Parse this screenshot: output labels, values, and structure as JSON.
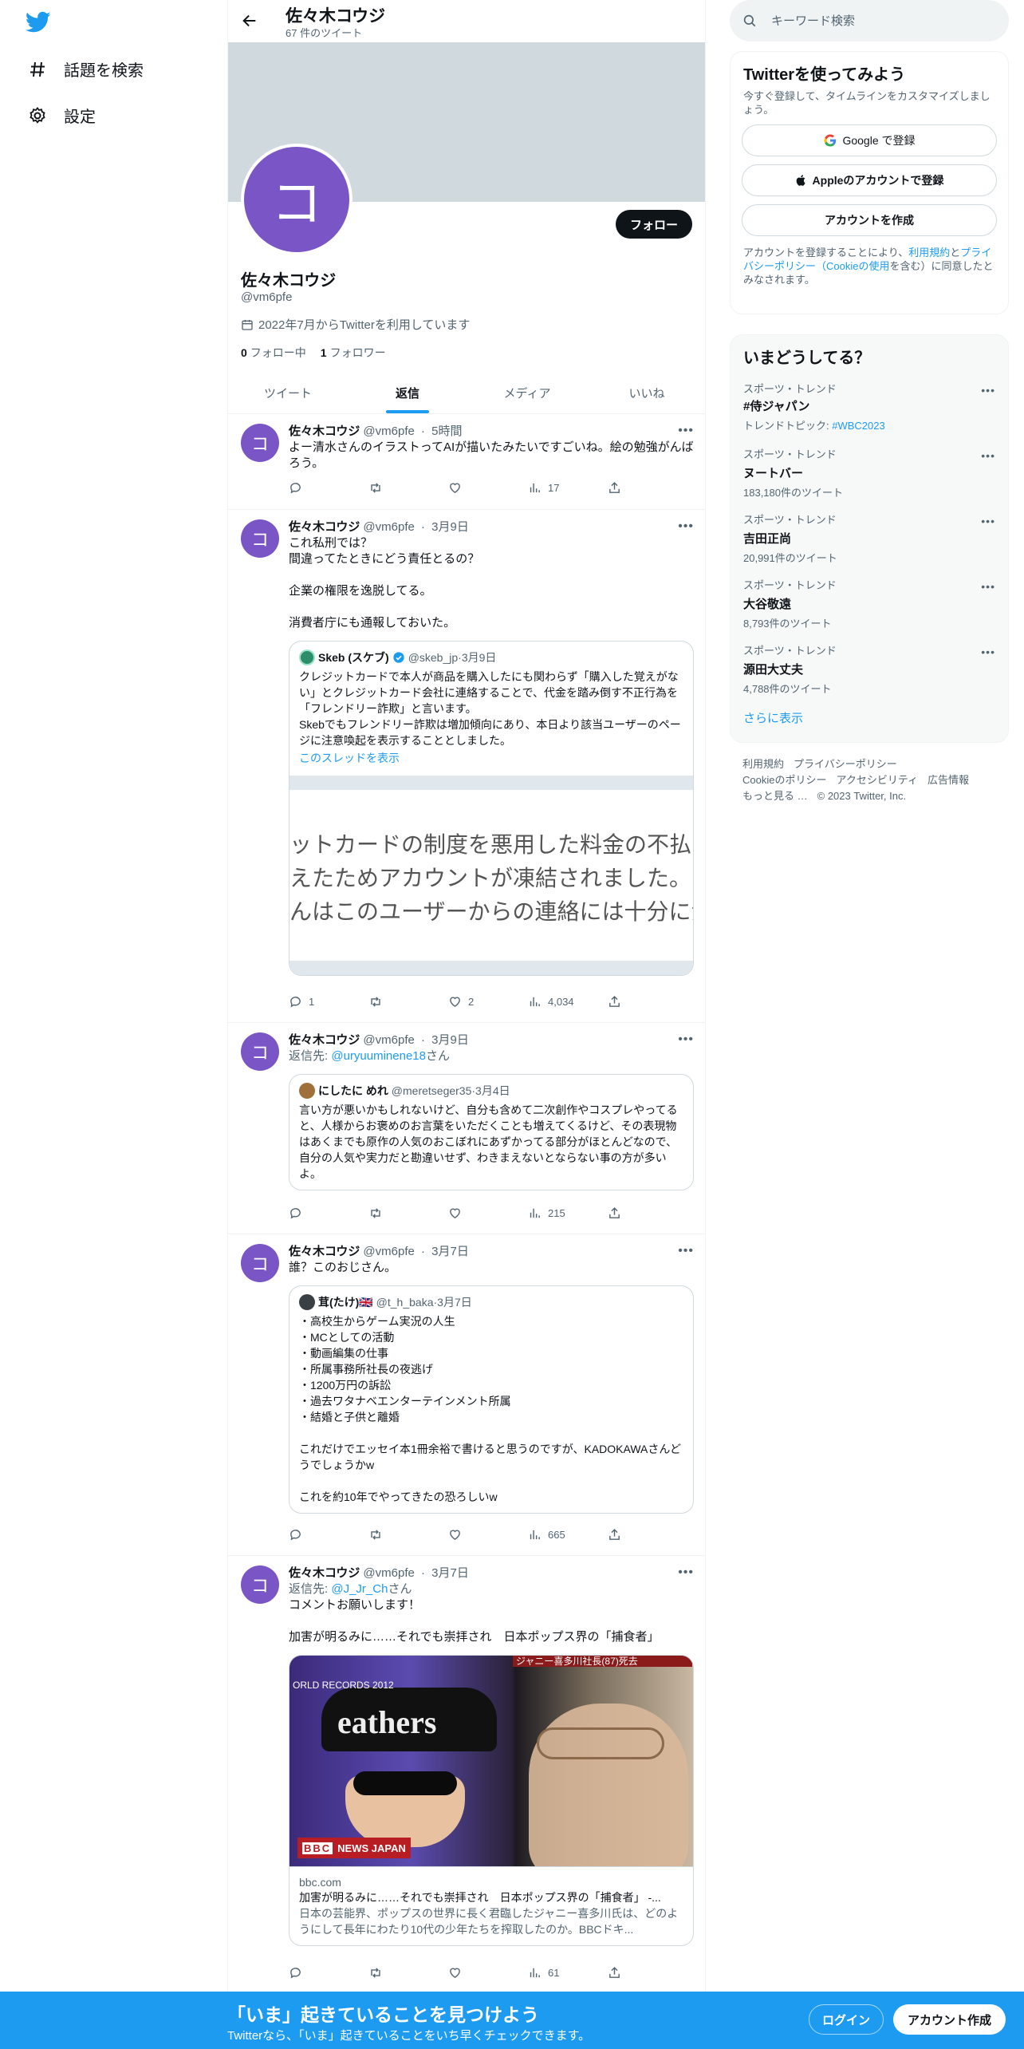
{
  "nav": {
    "explore_label": "話題を検索",
    "settings_label": "設定"
  },
  "header": {
    "name": "佐々木コウジ",
    "tweet_count": "67 件のツイート"
  },
  "profile": {
    "avatar_letter": "コ",
    "follow_label": "フォロー",
    "name": "佐々木コウジ",
    "handle": "@vm6pfe",
    "joined": "2022年7月からTwitterを利用しています",
    "following_count": "0",
    "following_label": "フォロー中",
    "followers_count": "1",
    "followers_label": "フォロワー"
  },
  "tabs": [
    {
      "label": "ツイート",
      "active": false
    },
    {
      "label": "返信",
      "active": true
    },
    {
      "label": "メディア",
      "active": false
    },
    {
      "label": "いいね",
      "active": false
    }
  ],
  "tweets": [
    {
      "name": "佐々木コウジ",
      "handle": "@vm6pfe",
      "time": "5時間",
      "text": "よー清水さんのイラストってAIが描いたみたいですごいね。絵の勉強がんばろう。",
      "replies": "",
      "retweets": "",
      "likes": "",
      "views": "17"
    },
    {
      "name": "佐々木コウジ",
      "handle": "@vm6pfe",
      "time": "3月9日",
      "text": "これ私刑では？\n間違ってたときにどう責任とるの？\n\n企業の権限を逸脱してる。\n\n消費者庁にも通報しておいた。",
      "quote": {
        "name": "Skeb (スケブ)",
        "handle": "@skeb_jp",
        "time": "3月9日",
        "text": "クレジットカードで本人が商品を購入したにも関わらず「購入した覚えがない」とクレジットカード会社に連絡することで、代金を踏み倒す不正行為を「フレンドリー詐欺」と言います。\nSkebでもフレンドリー詐欺は増加傾向にあり、本日より該当ユーザーのページに注意喚起を表示することとしました。",
        "thread_link": "このスレッドを表示",
        "image_lines": [
          "ットカードの制度を悪用した料金の不払い",
          "えたためアカウントが凍結されました。",
          "んはこのユーザーからの連絡には十分に注"
        ]
      },
      "replies": "1",
      "retweets": "",
      "likes": "2",
      "views": "4,034"
    },
    {
      "name": "佐々木コウジ",
      "handle": "@vm6pfe",
      "time": "3月9日",
      "reply_prefix": "返信先: ",
      "reply_to": "@uryuuminene18",
      "reply_suffix": "さん",
      "quote": {
        "name": "にしたに めれ",
        "handle": "@meretseger35",
        "time": "3月4日",
        "text": "言い方が悪いかもしれないけど、自分も含めて二次創作やコスプレやってると、人様からお褒めのお言葉をいただくことも増えてくるけど、その表現物はあくまでも原作の人気のおこぼれにあずかってる部分がほとんどなので、自分の人気や実力だと勘違いせず、わきまえないとならない事の方が多いよ。"
      },
      "replies": "",
      "retweets": "",
      "likes": "",
      "views": "215"
    },
    {
      "name": "佐々木コウジ",
      "handle": "@vm6pfe",
      "time": "3月7日",
      "text": "誰？このおじさん。",
      "quote": {
        "name": "茸(たけ)🇬🇧",
        "handle": "@t_h_baka",
        "time": "3月7日",
        "text": "・高校生からゲーム実況の人生\n・MCとしての活動\n・動画編集の仕事\n・所属事務所社長の夜逃げ\n・1200万円の訴訟\n・過去ワタナベエンターテインメント所属\n・結婚と子供と離婚\n\nこれだけでエッセイ本1冊余裕で書けると思うのですが、KADOKAWAさんどうでしょうかw\n\nこれを約10年でやってきたの恐ろしいw"
      },
      "replies": "",
      "retweets": "",
      "likes": "",
      "views": "665"
    },
    {
      "name": "佐々木コウジ",
      "handle": "@vm6pfe",
      "time": "3月7日",
      "reply_prefix": "返信先: ",
      "reply_to": "@J_Jr_Ch",
      "reply_suffix": "さん",
      "text": "コメントお願いします！\n\n加害が明るみに……それでも崇拝され　日本ポップス界の「捕食者」",
      "card": {
        "domain": "bbc.com",
        "title": "加害が明るみに……それでも崇拝され　日本ポップス界の「捕食者」 -...",
        "desc": "日本の芸能界、ポップスの世界に長く君臨したジャニー喜多川氏は、どのようにして長年にわたり10代の少年たちを搾取したのか。BBCドキ...",
        "image_caption": "ジャニー喜多川社長(87)死去",
        "cap_text": "eathers",
        "record_text": "ORLD RECORDS 2012",
        "bbc_badge": "BBC",
        "news_label": "NEWS JAPAN"
      },
      "replies": "",
      "retweets": "",
      "likes": "",
      "views": "61"
    }
  ],
  "search": {
    "placeholder": "キーワード検索"
  },
  "signup": {
    "title": "Twitterを使ってみよう",
    "subtitle": "今すぐ登録して、タイムラインをカスタマイズしましょう。",
    "google_label": "Google で登録",
    "apple_label": "Appleのアカウントで登録",
    "create_label": "アカウントを作成",
    "terms_1": "アカウントを登録することにより、",
    "terms_link1": "利用規約",
    "terms_2": "と",
    "terms_link2": "プライバシーポリシー（Cookieの使用",
    "terms_3": "を含む）に同意したとみなされます。"
  },
  "trends": {
    "title": "いまどうしてる？",
    "items": [
      {
        "category": "スポーツ・トレンド",
        "name": "#侍ジャパン",
        "extra_prefix": "トレンドトピック: ",
        "extra_link": "#WBC2023"
      },
      {
        "category": "スポーツ・トレンド",
        "name": "ヌートバー",
        "count": "183,180件のツイート"
      },
      {
        "category": "スポーツ・トレンド",
        "name": "吉田正尚",
        "count": "20,991件のツイート"
      },
      {
        "category": "スポーツ・トレンド",
        "name": "大谷敬遠",
        "count": "8,793件のツイート"
      },
      {
        "category": "スポーツ・トレンド",
        "name": "源田大丈夫",
        "count": "4,788件のツイート"
      }
    ],
    "show_more": "さらに表示"
  },
  "footer": {
    "links": [
      "利用規約",
      "プライバシーポリシー",
      "Cookieのポリシー",
      "アクセシビリティ",
      "広告情報",
      "もっと見る …"
    ],
    "copyright": "© 2023 Twitter, Inc."
  },
  "bottom": {
    "title": "「いま」起きていることを見つけよう",
    "subtitle": "Twitterなら、「いま」起きていることをいち早くチェックできます。",
    "login": "ログイン",
    "signup": "アカウント作成"
  },
  "colors": {
    "accent": "#1d9bf0",
    "avatar": "#7a55c5",
    "banner": "#cfd9de"
  }
}
